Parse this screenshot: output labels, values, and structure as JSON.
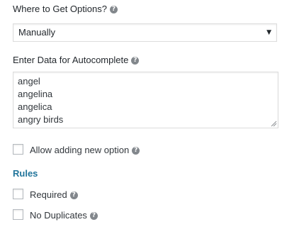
{
  "options_source": {
    "label": "Where to Get Options?",
    "selected_value": "Manually",
    "help_icon": "question-circle-icon"
  },
  "autocomplete": {
    "label": "Enter Data for Autocomplete",
    "help_icon": "question-circle-icon",
    "lines": [
      "angel",
      "angelina",
      "angelica",
      "angry birds"
    ]
  },
  "allow_new": {
    "label": "Allow adding new option",
    "checked": false
  },
  "rules": {
    "heading": "Rules",
    "heading_color": "#21759b",
    "items": [
      {
        "label": "Required",
        "checked": false
      },
      {
        "label": "No Duplicates",
        "checked": false
      }
    ]
  },
  "icons": {
    "help_glyph": "?",
    "caret_glyph": "▼"
  }
}
